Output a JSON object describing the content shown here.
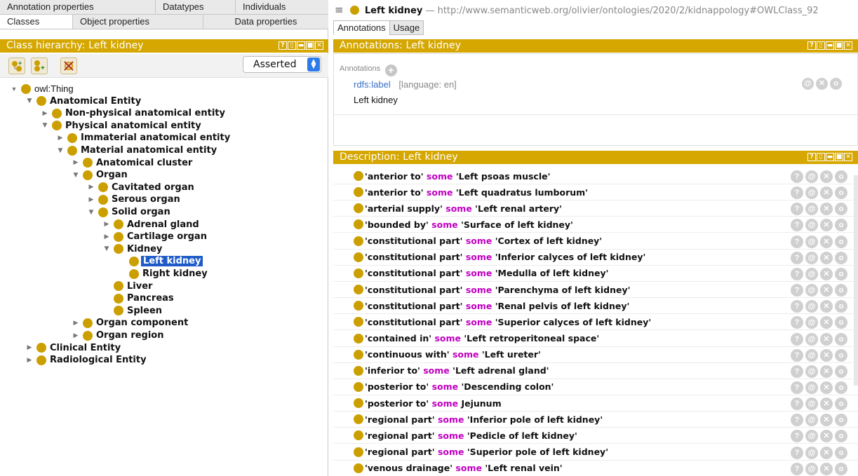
{
  "left_tabs": {
    "row1": [
      "Annotation properties",
      "Datatypes",
      "Individuals"
    ],
    "row2": [
      "Classes",
      "Object properties",
      "Data properties"
    ]
  },
  "class_hierarchy": {
    "title": "Class hierarchy: Left kidney",
    "view_mode": "Asserted",
    "items": [
      {
        "label": "owl:Thing",
        "depth": 0,
        "toggle": "expanded",
        "plain": true
      },
      {
        "label": "Anatomical Entity",
        "depth": 1,
        "toggle": "expanded"
      },
      {
        "label": "Non-physical anatomical entity",
        "depth": 2,
        "toggle": "collapsed"
      },
      {
        "label": "Physical anatomical entity",
        "depth": 2,
        "toggle": "expanded"
      },
      {
        "label": "Immaterial anatomical entity",
        "depth": 3,
        "toggle": "collapsed"
      },
      {
        "label": "Material anatomical entity",
        "depth": 3,
        "toggle": "expanded"
      },
      {
        "label": "Anatomical cluster",
        "depth": 4,
        "toggle": "collapsed"
      },
      {
        "label": "Organ",
        "depth": 4,
        "toggle": "expanded"
      },
      {
        "label": "Cavitated organ",
        "depth": 5,
        "toggle": "collapsed"
      },
      {
        "label": "Serous organ",
        "depth": 5,
        "toggle": "collapsed"
      },
      {
        "label": "Solid organ",
        "depth": 5,
        "toggle": "expanded"
      },
      {
        "label": "Adrenal gland",
        "depth": 6,
        "toggle": "collapsed"
      },
      {
        "label": "Cartilage organ",
        "depth": 6,
        "toggle": "collapsed"
      },
      {
        "label": "Kidney",
        "depth": 6,
        "toggle": "expanded"
      },
      {
        "label": "Left kidney",
        "depth": 7,
        "toggle": "none",
        "selected": true
      },
      {
        "label": "Right kidney",
        "depth": 7,
        "toggle": "none"
      },
      {
        "label": "Liver",
        "depth": 6,
        "toggle": "none"
      },
      {
        "label": "Pancreas",
        "depth": 6,
        "toggle": "none"
      },
      {
        "label": "Spleen",
        "depth": 6,
        "toggle": "none"
      },
      {
        "label": "Organ component",
        "depth": 4,
        "toggle": "collapsed"
      },
      {
        "label": "Organ region",
        "depth": 4,
        "toggle": "collapsed"
      },
      {
        "label": "Clinical Entity",
        "depth": 1,
        "toggle": "collapsed"
      },
      {
        "label": "Radiological Entity",
        "depth": 1,
        "toggle": "collapsed"
      }
    ]
  },
  "entity_bar": {
    "name": "Left kidney",
    "iri": "— http://www.semanticweb.org/olivier/ontologies/2020/2/kidnappology#OWLClass_92"
  },
  "right_tabs": [
    "Annotations",
    "Usage"
  ],
  "annotations_view": {
    "title": "Annotations: Left kidney",
    "header_label": "Annotations",
    "property": "rdfs:label",
    "language": "[language: en]",
    "value": "Left kidney"
  },
  "description_view": {
    "title": "Description: Left kidney",
    "rows": [
      {
        "prop": "'anterior to'",
        "kw": "some",
        "filler": "'Left psoas muscle'"
      },
      {
        "prop": "'anterior to'",
        "kw": "some",
        "filler": "'Left quadratus lumborum'"
      },
      {
        "prop": "'arterial supply'",
        "kw": "some",
        "filler": "'Left renal artery'"
      },
      {
        "prop": "'bounded by'",
        "kw": "some",
        "filler": "'Surface of left kidney'"
      },
      {
        "prop": "'constitutional part'",
        "kw": "some",
        "filler": "'Cortex of left kidney'"
      },
      {
        "prop": "'constitutional part'",
        "kw": "some",
        "filler": "'Inferior calyces of left kidney'"
      },
      {
        "prop": "'constitutional part'",
        "kw": "some",
        "filler": "'Medulla of left kidney'"
      },
      {
        "prop": "'constitutional part'",
        "kw": "some",
        "filler": "'Parenchyma of left kidney'"
      },
      {
        "prop": "'constitutional part'",
        "kw": "some",
        "filler": "'Renal pelvis of left kidney'"
      },
      {
        "prop": "'constitutional part'",
        "kw": "some",
        "filler": "'Superior calyces of left kidney'"
      },
      {
        "prop": "'contained in'",
        "kw": "some",
        "filler": "'Left retroperitoneal space'"
      },
      {
        "prop": "'continuous with'",
        "kw": "some",
        "filler": "'Left ureter'"
      },
      {
        "prop": "'inferior to'",
        "kw": "some",
        "filler": "'Left adrenal gland'"
      },
      {
        "prop": "'posterior to'",
        "kw": "some",
        "filler": "'Descending colon'"
      },
      {
        "prop": "'posterior to'",
        "kw": "some",
        "filler": "Jejunum"
      },
      {
        "prop": "'regional part'",
        "kw": "some",
        "filler": "'Inferior pole of left kidney'"
      },
      {
        "prop": "'regional part'",
        "kw": "some",
        "filler": "'Pedicle of left kidney'"
      },
      {
        "prop": "'regional part'",
        "kw": "some",
        "filler": "'Superior pole of left kidney'"
      },
      {
        "prop": "'venous drainage'",
        "kw": "some",
        "filler": "'Left renal vein'"
      }
    ]
  },
  "colors": {
    "header_gold": "#d5a700",
    "class_dot": "#cc9f00",
    "keyword": "#c000c0",
    "selection": "#1f5bc8"
  },
  "icons": {
    "view_controls": [
      "help-icon",
      "pin-icon",
      "minimize-icon",
      "maximize-icon",
      "close-icon"
    ],
    "row_buttons": [
      "help-icon",
      "at-icon",
      "delete-icon",
      "edit-icon"
    ]
  }
}
